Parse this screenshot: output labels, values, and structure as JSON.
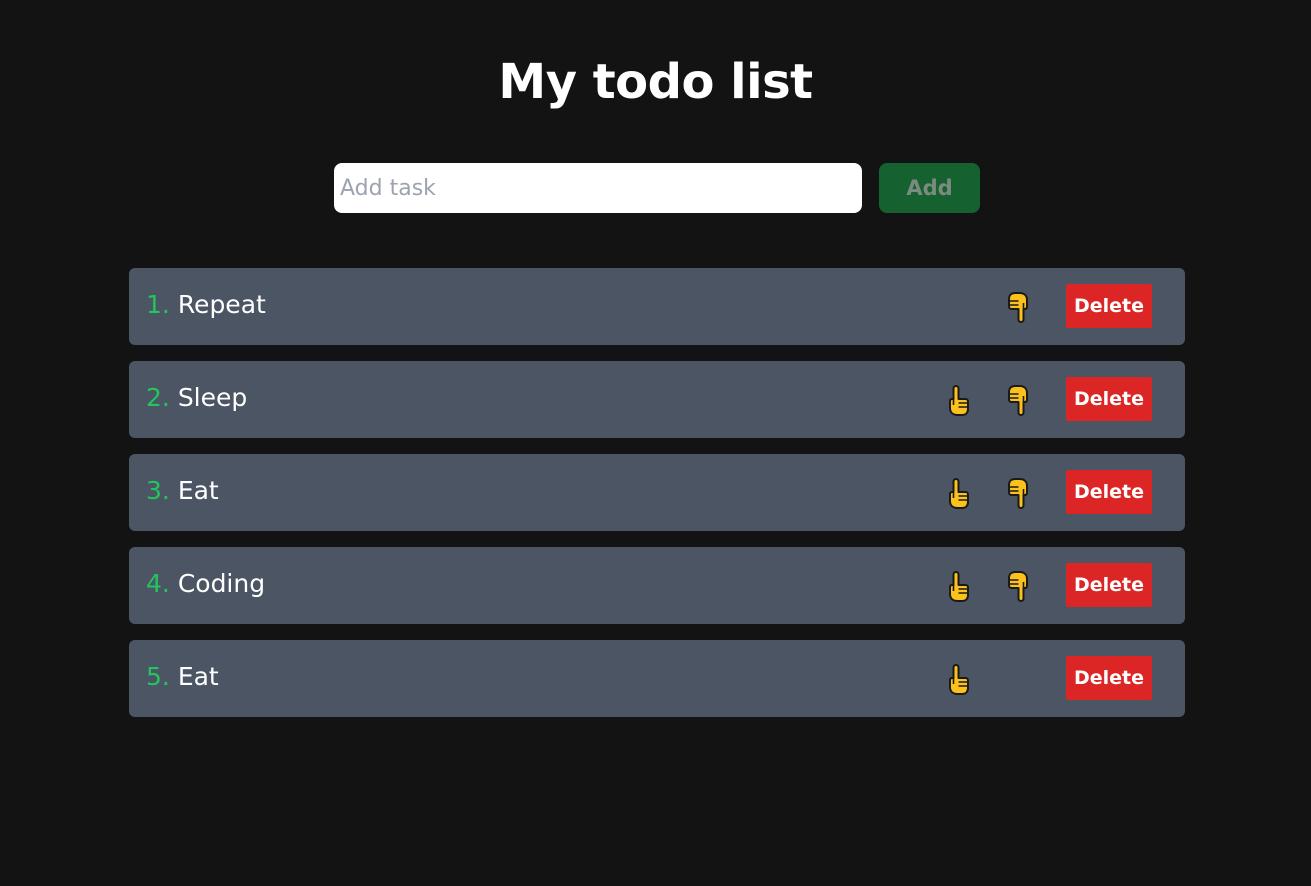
{
  "page": {
    "title": "My todo list"
  },
  "form": {
    "input_placeholder": "Add task",
    "input_value": "",
    "add_label": "Add"
  },
  "tasks": [
    {
      "number": "1.",
      "label": "Repeat",
      "has_up": false,
      "has_down": true,
      "delete_label": "Delete"
    },
    {
      "number": "2.",
      "label": "Sleep",
      "has_up": true,
      "has_down": true,
      "delete_label": "Delete"
    },
    {
      "number": "3.",
      "label": "Eat",
      "has_up": true,
      "has_down": true,
      "delete_label": "Delete"
    },
    {
      "number": "4.",
      "label": "Coding",
      "has_up": true,
      "has_down": true,
      "delete_label": "Delete"
    },
    {
      "number": "5.",
      "label": "Eat",
      "has_up": true,
      "has_down": false,
      "delete_label": "Delete"
    }
  ],
  "icons": {
    "move_up": "pointing-up-hand-icon",
    "move_down": "pointing-down-hand-icon"
  },
  "colors": {
    "background": "#131313",
    "card": "#4b5563",
    "number": "#22c55e",
    "add_button": "#15612f",
    "delete_button": "#dc2626",
    "hand": "#fcc21b"
  }
}
